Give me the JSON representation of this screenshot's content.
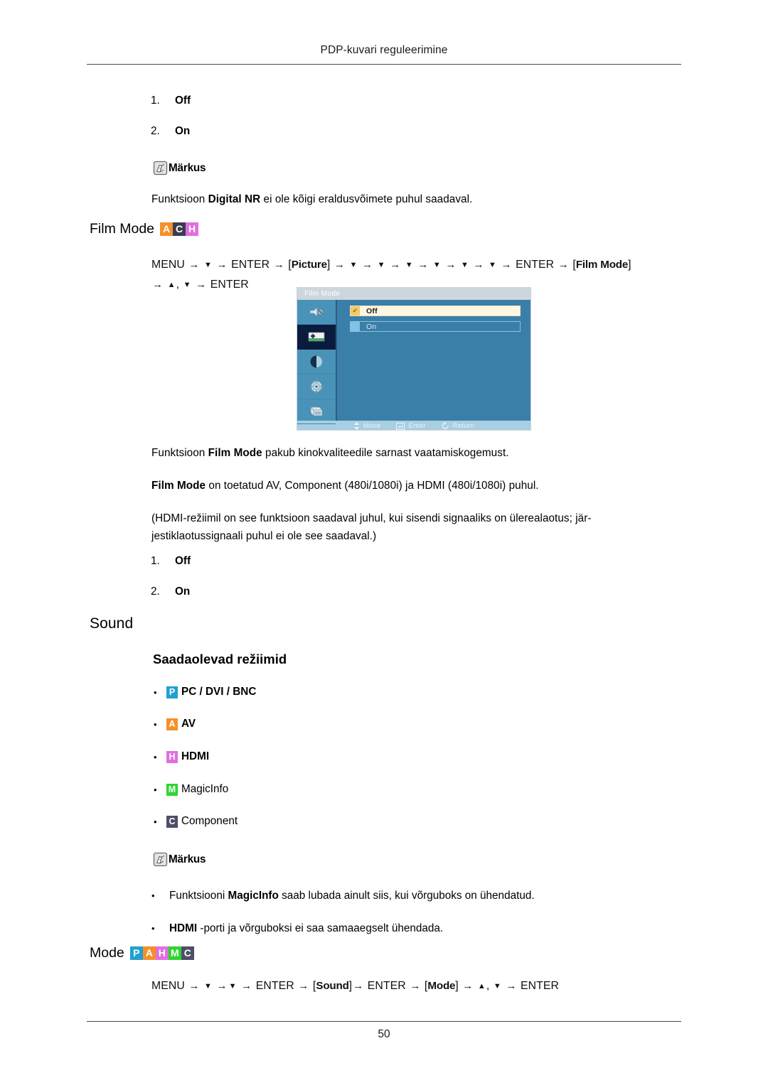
{
  "header": {
    "title": "PDP-kuvari reguleerimine"
  },
  "footer": {
    "page_number": "50"
  },
  "badge_colors": {
    "P": "#22a0d0",
    "A": "#f5902a",
    "H": "#e06fe0",
    "M": "#2ed62e",
    "C": "#4e4e68"
  },
  "digital_nr": {
    "options": [
      {
        "num": "1.",
        "label": "Off"
      },
      {
        "num": "2.",
        "label": "On"
      }
    ],
    "note_label": "Märkus",
    "note_text_1": "Funktsioon ",
    "note_text_bold": "Digital NR",
    "note_text_2": " ei ole kõigi eraldusvõimete puhul saadaval."
  },
  "film_mode": {
    "heading": "Film Mode",
    "badges": [
      "A",
      "C",
      "H"
    ],
    "menu_path": {
      "start": "MENU",
      "enter": "ENTER",
      "picture_token": "Picture",
      "film_mode_token": "Film Mode",
      "line2_tail": "ENTER"
    },
    "osd": {
      "title": "Film Mode",
      "options": [
        {
          "label": "Off",
          "selected": true
        },
        {
          "label": "On",
          "selected": false
        }
      ],
      "footer": [
        {
          "icon": "updown-arrow-icon",
          "label": "Move"
        },
        {
          "icon": "enter-key-icon",
          "label": "Enter"
        },
        {
          "icon": "return-arrow-icon",
          "label": "Return"
        }
      ],
      "sidebar_icons": [
        "picture-mute-icon",
        "picture-settings-icon",
        "contrast-icon",
        "setup-gear-icon",
        "multi-control-icon"
      ],
      "active_sidebar_index": 1
    },
    "para_1_pre": "Funktsioon ",
    "para_1_bold": "Film Mode",
    "para_1_post": " pakub kinokvaliteedile sarnast vaatamiskogemust.",
    "para_2_bold": "Film Mode",
    "para_2_post": " on toetatud AV, Component (480i/1080i) ja HDMI (480i/1080i) puhul.",
    "para_3_line1": "(HDMI-režiimil on see funktsioon saadaval juhul, kui sisendi signaaliks on ülerealaotus; jär-",
    "para_3_line2": "jestiklaotussignaali puhul ei ole see saadaval.)",
    "options": [
      {
        "num": "1.",
        "label": "Off"
      },
      {
        "num": "2.",
        "label": "On"
      }
    ]
  },
  "sound": {
    "heading": "Sound",
    "subheading": "Saadaolevad režiimid",
    "mode_list": [
      {
        "badge": "P",
        "label": "PC / DVI / BNC",
        "bold": true
      },
      {
        "badge": "A",
        "label": "AV",
        "bold": true
      },
      {
        "badge": "H",
        "label": "HDMI",
        "bold": true
      },
      {
        "badge": "M",
        "label": "MagicInfo",
        "bold": false
      },
      {
        "badge": "C",
        "label": "Component",
        "bold": false
      }
    ],
    "note_label": "Märkus",
    "notes": [
      {
        "pre": "Funktsiooni ",
        "bold": "MagicInfo",
        "post": " saab lubada ainult siis, kui võrguboks on ühendatud."
      },
      {
        "pre": "",
        "bold": "HDMI",
        "post": " -porti ja võrguboksi ei saa samaaegselt ühendada."
      }
    ]
  },
  "mode_section": {
    "heading": "Mode",
    "badges": [
      "P",
      "A",
      "H",
      "M",
      "C"
    ],
    "menu_path": {
      "start": "MENU",
      "enter": "ENTER",
      "sound_token": "Sound",
      "mode_token": "Mode"
    }
  },
  "symbols": {
    "arrow": "→",
    "down": "▼",
    "up": "▲",
    "comma": ",",
    "bracket_open": "[",
    "bracket_close": "]",
    "bullet": "•",
    "check": "✔"
  }
}
